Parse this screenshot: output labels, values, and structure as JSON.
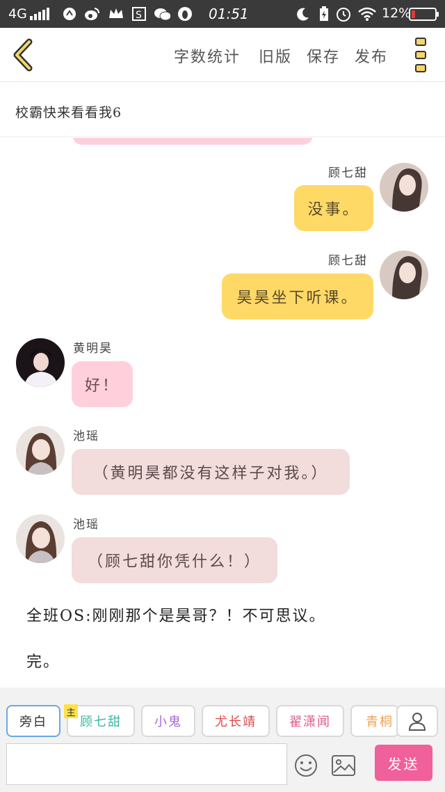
{
  "status_bar": {
    "network": "4G",
    "time": "01:51",
    "battery": "12%"
  },
  "top_bar": {
    "menu": [
      "字数统计",
      "旧版",
      "保存",
      "发布"
    ]
  },
  "title": "校霸快来看看我6",
  "messages": [
    {
      "side": "right",
      "name": "顾七甜",
      "text": "没事。"
    },
    {
      "side": "right",
      "name": "顾七甜",
      "text": "昊昊坐下听课。"
    },
    {
      "side": "left",
      "name": "黄明昊",
      "text": "好！"
    },
    {
      "side": "left",
      "name": "池瑶",
      "text": "（黄明昊都没有这样子对我。）"
    },
    {
      "side": "left",
      "name": "池瑶",
      "text": "（顾七甜你凭什么！）"
    }
  ],
  "narrations": [
    "全班OS:刚刚那个是昊哥？！不可思议。",
    "完。"
  ],
  "characters": {
    "main_tag": "主",
    "list": [
      "旁白",
      "顾七甜",
      "小鬼",
      "尤长靖",
      "翟潇闻",
      "青桐"
    ]
  },
  "input": {
    "placeholder": "",
    "value": ""
  },
  "send_label": "发送",
  "colors": {
    "bubble_yellow": "#ffd966",
    "bubble_pink": "#ffd0dc",
    "bubble_rose": "#f2dcdc",
    "send_button": "#f0609a"
  }
}
